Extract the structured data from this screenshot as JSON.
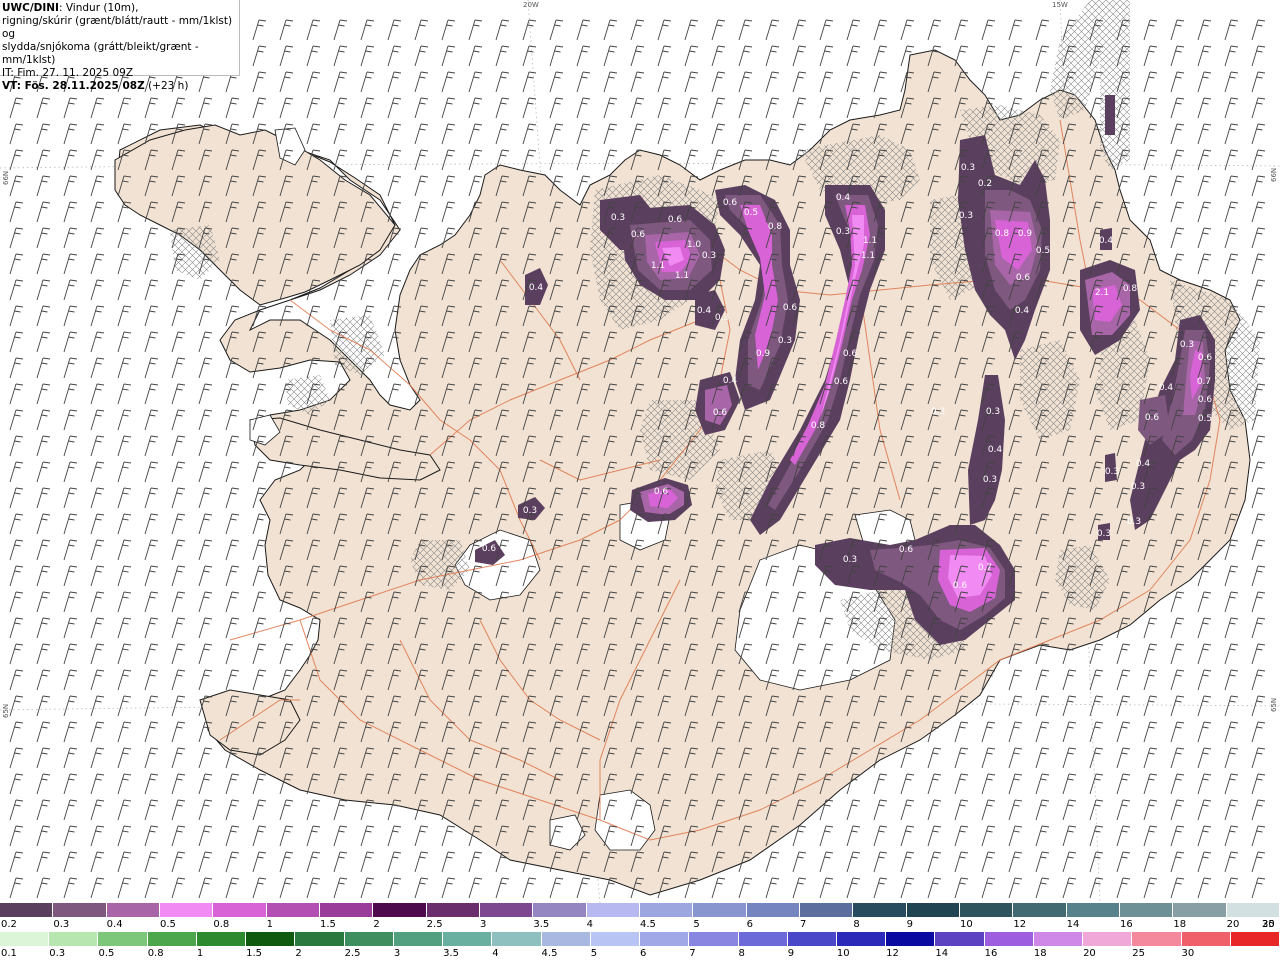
{
  "header": {
    "model": "UWC/DINI",
    "line1_rest": ": Vindur (10m),",
    "line2": "rigning/skúrir (grænt/blátt/rautt - mm/1klst) og",
    "line3": "slydda/snjókoma (grátt/bleikt/grænt - mm/1klst)",
    "issue_time": "IT: Fim. 27. 11. 2025 09Z",
    "valid_prefix": "VT: Fös. 28.11.2025 08Z",
    "valid_suffix": " (+23 h)"
  },
  "graticule": {
    "lon_labels": [
      "20W",
      "15W"
    ],
    "lat_labels": [
      "66N",
      "65N"
    ]
  },
  "precip_labels": [
    {
      "id": "w1",
      "v": "0.4"
    },
    {
      "id": "w2",
      "v": "0.3"
    },
    {
      "id": "n1",
      "v": "0.3"
    },
    {
      "id": "n2",
      "v": "0.6"
    },
    {
      "id": "n3",
      "v": "0.6"
    },
    {
      "id": "n4",
      "v": "1.1"
    },
    {
      "id": "n5",
      "v": "1.0"
    },
    {
      "id": "n6",
      "v": "1.1"
    },
    {
      "id": "n7",
      "v": "0.3"
    },
    {
      "id": "n8",
      "v": "0.4"
    },
    {
      "id": "n9",
      "v": "0.3"
    },
    {
      "id": "e1",
      "v": "0.6"
    },
    {
      "id": "e2",
      "v": "0.5"
    },
    {
      "id": "e3",
      "v": "0.8"
    },
    {
      "id": "e4",
      "v": "0.6"
    },
    {
      "id": "e5",
      "v": "0.9"
    },
    {
      "id": "e6",
      "v": "0.3"
    },
    {
      "id": "e7",
      "v": "0.4"
    },
    {
      "id": "e8",
      "v": "0.6"
    },
    {
      "id": "c1",
      "v": "0.4"
    },
    {
      "id": "c2",
      "v": "0.3"
    },
    {
      "id": "c3",
      "v": "1.1"
    },
    {
      "id": "c4",
      "v": "1.1"
    },
    {
      "id": "c5",
      "v": "0.6"
    },
    {
      "id": "c6",
      "v": "0.6"
    },
    {
      "id": "c7",
      "v": "0.8"
    },
    {
      "id": "c8",
      "v": "0.6"
    },
    {
      "id": "ne1",
      "v": "0.3"
    },
    {
      "id": "ne2",
      "v": "0.2"
    },
    {
      "id": "ne3",
      "v": "0.3"
    },
    {
      "id": "ne4",
      "v": "0.8"
    },
    {
      "id": "ne5",
      "v": "0.9"
    },
    {
      "id": "ne6",
      "v": "0.5"
    },
    {
      "id": "ne7",
      "v": "0.6"
    },
    {
      "id": "ne8",
      "v": "0.4"
    },
    {
      "id": "ne9",
      "v": "2.1"
    },
    {
      "id": "ne10",
      "v": "0.8"
    },
    {
      "id": "s1",
      "v": "0.3"
    },
    {
      "id": "s2",
      "v": "0.4"
    },
    {
      "id": "s3",
      "v": "0.3"
    },
    {
      "id": "s4",
      "v": "0.3"
    },
    {
      "id": "s5",
      "v": "0.6"
    },
    {
      "id": "s6",
      "v": "0.6"
    },
    {
      "id": "s7",
      "v": "0.7"
    },
    {
      "id": "f1",
      "v": "0.3"
    },
    {
      "id": "f2",
      "v": "0.6"
    },
    {
      "id": "f3",
      "v": "0.4"
    },
    {
      "id": "f4",
      "v": "0.7"
    },
    {
      "id": "f5",
      "v": "0.6"
    },
    {
      "id": "f6",
      "v": "0.6"
    },
    {
      "id": "f7",
      "v": "0.5"
    },
    {
      "id": "f8",
      "v": "0.4"
    },
    {
      "id": "f9",
      "v": "0.3"
    },
    {
      "id": "f10",
      "v": "0.3"
    },
    {
      "id": "f11",
      "v": "0.3"
    },
    {
      "id": "f12",
      "v": "0.3"
    },
    {
      "id": "f13",
      "v": "0.6"
    },
    {
      "id": "i1",
      "v": "0.3"
    },
    {
      "id": "i2",
      "v": "0.4"
    }
  ],
  "legend": {
    "snow": {
      "colors": [
        "#5b3f5e",
        "#7e587f",
        "#a866a8",
        "#f18af2",
        "#d763d6",
        "#b34fb2",
        "#9a3c99",
        "#4d0a4d",
        "#6a2e6c",
        "#7d4890",
        "#9585c0",
        "#b7b8ef",
        "#9ea6e0",
        "#8995cf",
        "#7585bf",
        "#5c6e9e",
        "#284c5f",
        "#204452",
        "#30545e",
        "#426a72",
        "#57828b",
        "#6d9097",
        "#889fa6",
        "#d2e0e1"
      ],
      "labels": [
        "0.2",
        "0.3",
        "0.4",
        "0.5",
        "0.8",
        "1",
        "1.5",
        "2",
        "2.5",
        "3",
        "3.5",
        "4",
        "4.5",
        "5",
        "6",
        "7",
        "8",
        "9",
        "10",
        "12",
        "14",
        "16",
        "18",
        "20",
        "25",
        "30"
      ]
    },
    "rain": {
      "colors": [
        "#dcf5d8",
        "#b7e6b0",
        "#7cc77a",
        "#4ea64c",
        "#2e8a2e",
        "#0f5a0f",
        "#2a7a40",
        "#3e8e60",
        "#53a080",
        "#6ab0a0",
        "#8ec0c0",
        "#a8b8e0",
        "#b8c4f4",
        "#a0a8e8",
        "#8886e0",
        "#6c6ad8",
        "#4a48c8",
        "#2c2ab8",
        "#0a0aa0",
        "#5c42c0",
        "#9d5ee0",
        "#d088e8",
        "#f0a8d8",
        "#f4889c",
        "#f0606a",
        "#e82828"
      ],
      "labels": [
        "0.1",
        "0.3",
        "0.5",
        "0.8",
        "1",
        "1.5",
        "2",
        "2.5",
        "3",
        "3.5",
        "4",
        "4.5",
        "5",
        "6",
        "7",
        "8",
        "9",
        "10",
        "12",
        "14",
        "16",
        "18",
        "20",
        "25",
        "30"
      ]
    }
  }
}
